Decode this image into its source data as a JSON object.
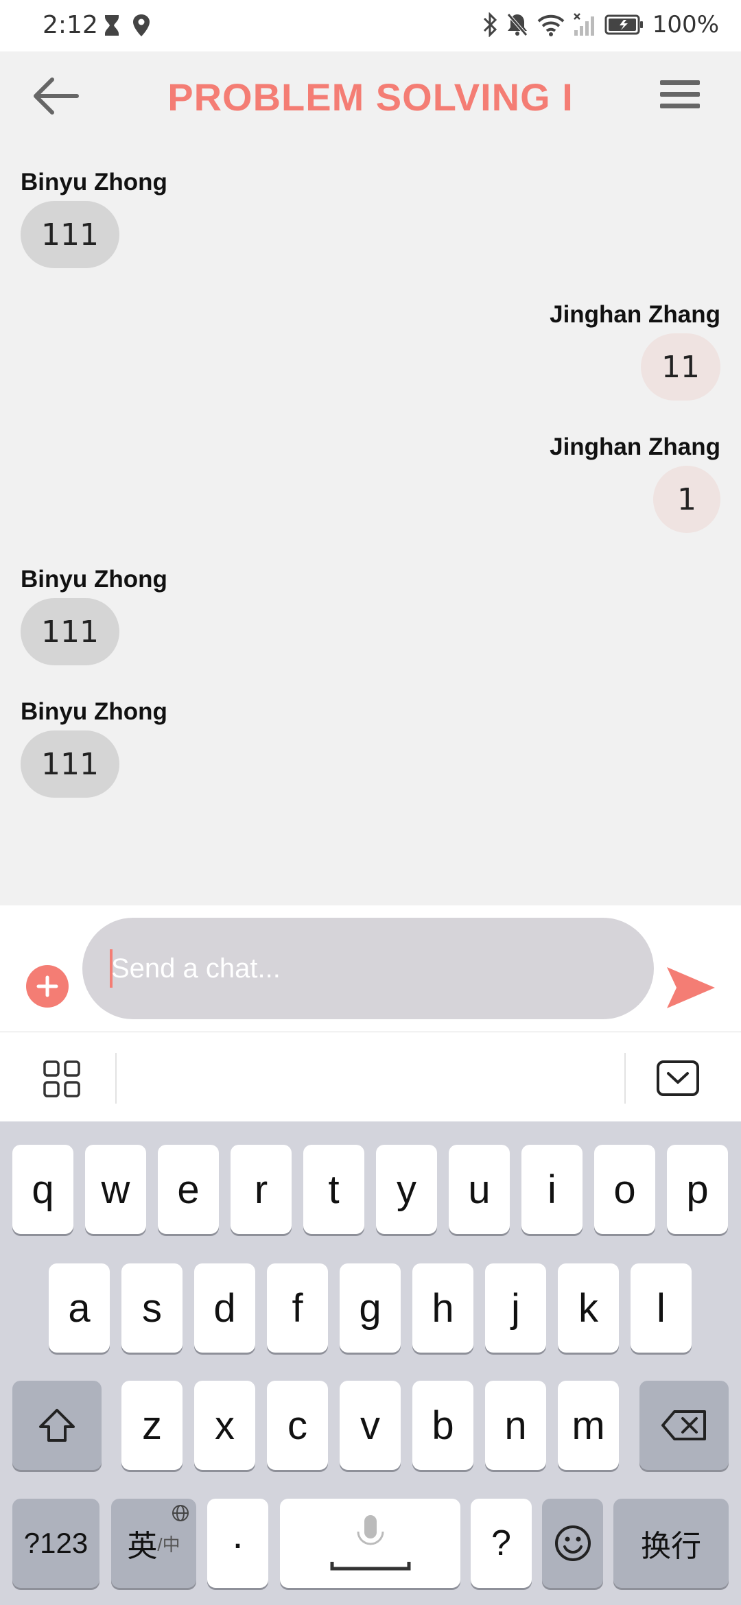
{
  "status_bar": {
    "time": "2:12",
    "battery": "100%"
  },
  "header": {
    "title": "PROBLEM SOLVING I"
  },
  "messages": [
    {
      "sender": "Binyu Zhong",
      "text": "111",
      "side": "left"
    },
    {
      "sender": "Jinghan Zhang",
      "text": "11",
      "side": "right"
    },
    {
      "sender": "Jinghan Zhang",
      "text": "1",
      "side": "right"
    },
    {
      "sender": "Binyu Zhong",
      "text": "111",
      "side": "left"
    },
    {
      "sender": "Binyu Zhong",
      "text": "111",
      "side": "left"
    }
  ],
  "composer": {
    "placeholder": "Send a chat..."
  },
  "keyboard": {
    "row1": [
      "q",
      "w",
      "e",
      "r",
      "t",
      "y",
      "u",
      "i",
      "o",
      "p"
    ],
    "row2": [
      "a",
      "s",
      "d",
      "f",
      "g",
      "h",
      "j",
      "k",
      "l"
    ],
    "row3": [
      "z",
      "x",
      "c",
      "v",
      "b",
      "n",
      "m"
    ],
    "numbers_key": "?123",
    "lang_key_main": "英",
    "lang_key_sub": "/中",
    "dot_key": "·",
    "question_key": "?",
    "enter_key": "换行"
  },
  "colors": {
    "accent": "#f47d74",
    "background": "#f1f1f1",
    "bubble_other": "#d5d5d5",
    "bubble_self": "#efe3e1"
  }
}
